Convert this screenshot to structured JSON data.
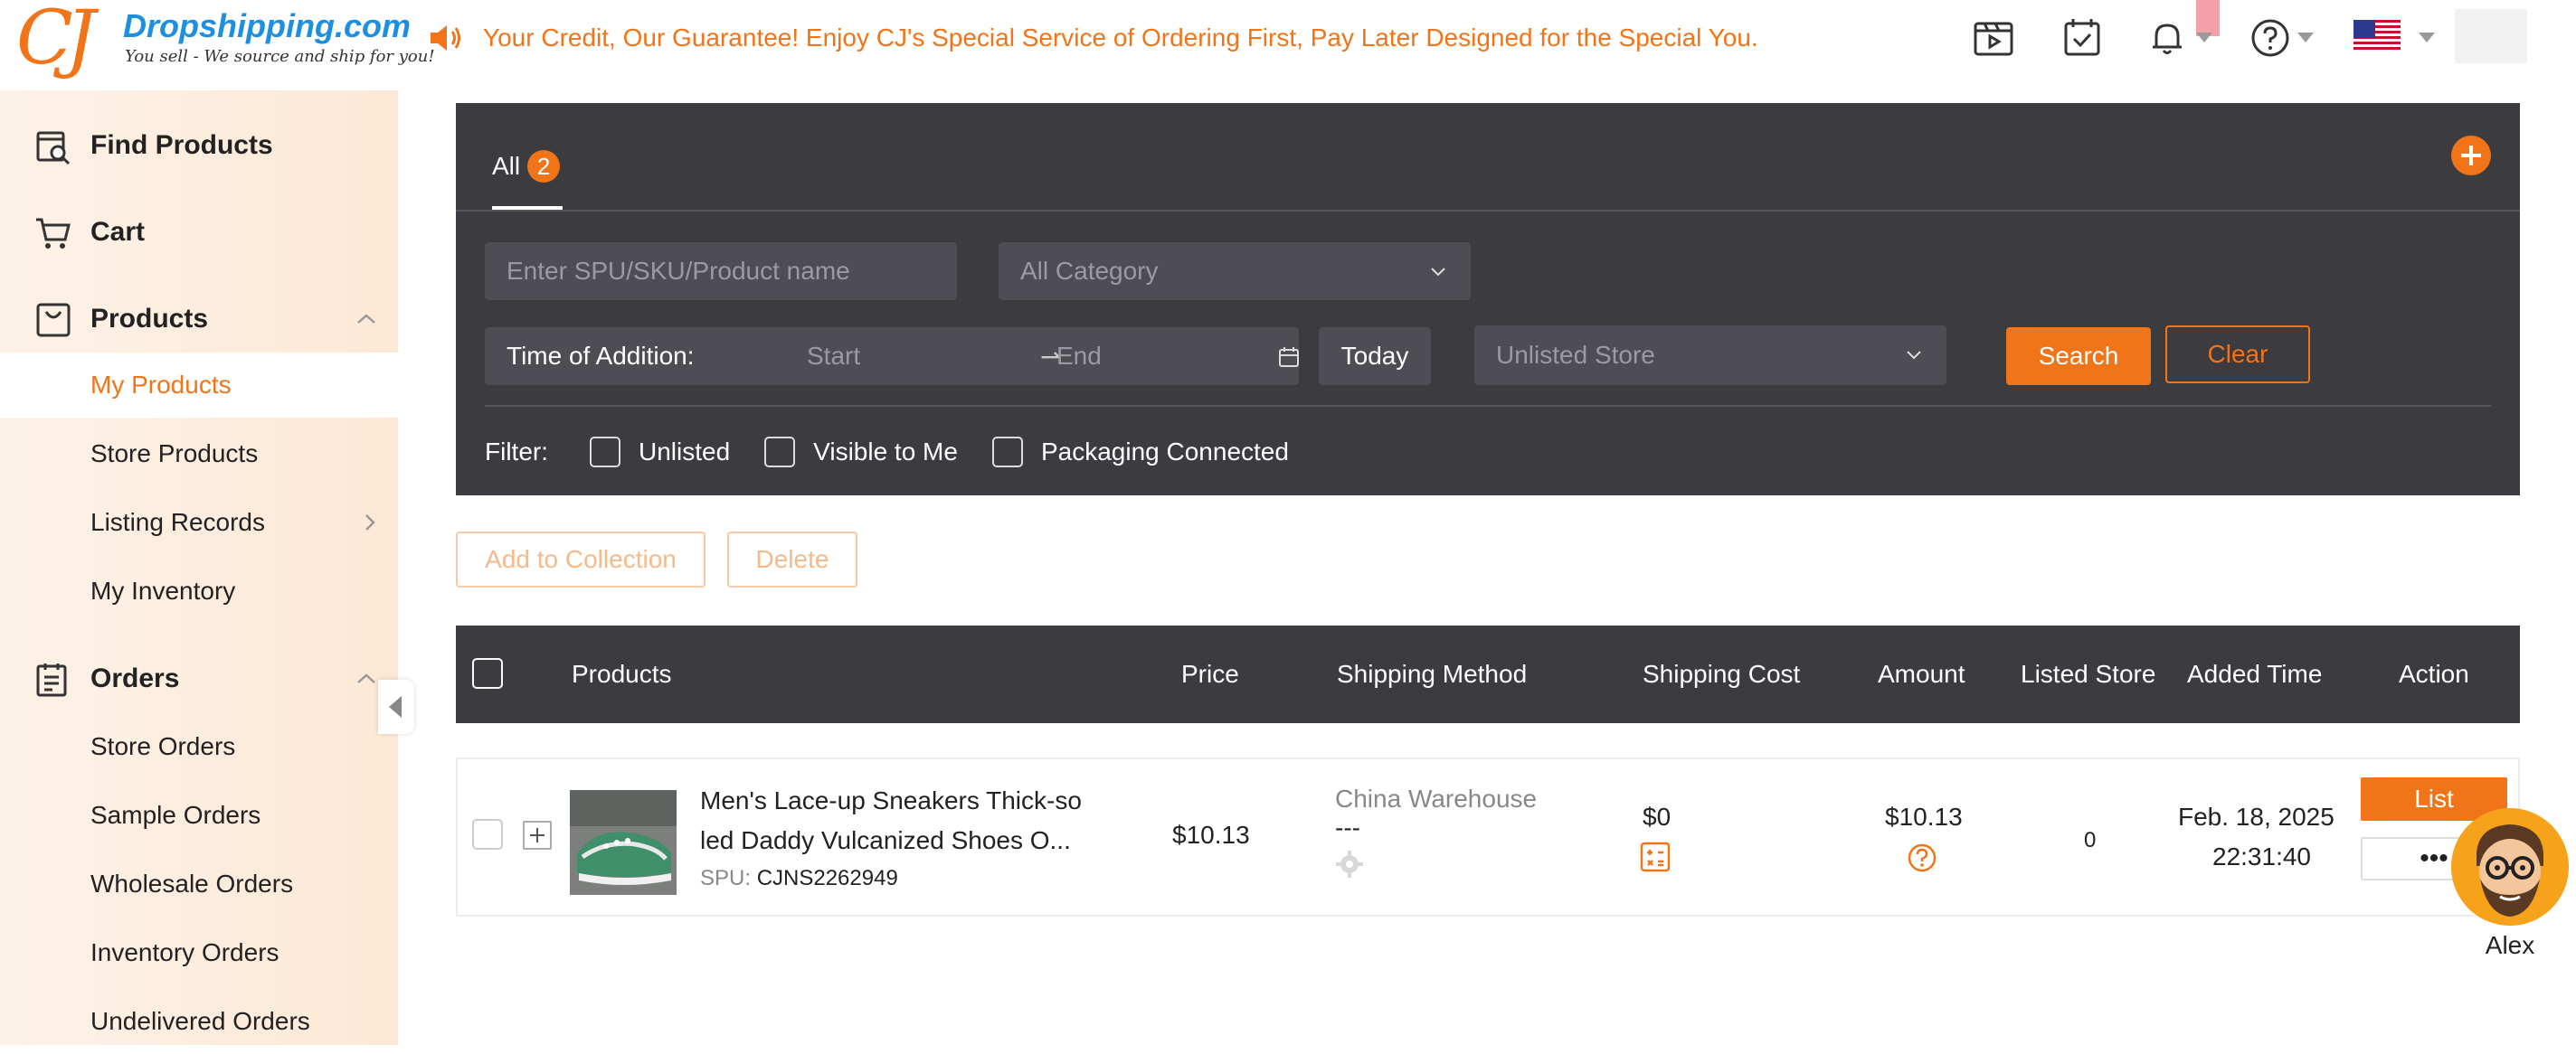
{
  "header": {
    "logo_mark": "CJ",
    "logo_name": "Dropshipping.com",
    "logo_tagline": "You sell - We source and ship for you!",
    "announcement": "Your Credit, Our Guarantee! Enjoy CJ's Special Service of Ordering First, Pay Later Designed for the Special You.",
    "icons": [
      "video-icon",
      "calendar-check-icon",
      "bell-icon",
      "help-icon",
      "us-flag-icon"
    ]
  },
  "sidebar": {
    "groups": [
      {
        "label": "Find Products",
        "icon": "find-products-icon"
      },
      {
        "label": "Cart",
        "icon": "cart-icon"
      },
      {
        "label": "Products",
        "icon": "bag-icon",
        "expanded": true,
        "items": [
          {
            "label": "My Products",
            "active": true
          },
          {
            "label": "Store Products"
          },
          {
            "label": "Listing Records",
            "has_submenu": true
          },
          {
            "label": "My Inventory"
          }
        ]
      },
      {
        "label": "Orders",
        "icon": "orders-icon",
        "expanded": true,
        "items": [
          {
            "label": "Store Orders"
          },
          {
            "label": "Sample Orders"
          },
          {
            "label": "Wholesale Orders"
          },
          {
            "label": "Inventory Orders"
          },
          {
            "label": "Undelivered Orders"
          }
        ]
      }
    ]
  },
  "filters": {
    "tab_label": "All",
    "tab_count": "2",
    "search_placeholder": "Enter SPU/SKU/Product name",
    "category_value": "All Category",
    "time_label": "Time of Addition:",
    "start_placeholder": "Start",
    "end_placeholder": "End",
    "today_label": "Today",
    "store_value": "Unlisted Store",
    "search_label": "Search",
    "clear_label": "Clear",
    "filter_label": "Filter:",
    "checkboxes": [
      "Unlisted",
      "Visible to Me",
      "Packaging Connected"
    ]
  },
  "actions": {
    "add_collection": "Add to Collection",
    "delete": "Delete"
  },
  "table": {
    "columns": [
      "Products",
      "Price",
      "Shipping Method",
      "Shipping Cost",
      "Amount",
      "Listed Store",
      "Added Time",
      "Action"
    ],
    "rows": [
      {
        "name_line1": "Men's Lace-up Sneakers Thick-so",
        "name_line2": "led Daddy Vulcanized Shoes O...",
        "spu_label": "SPU:",
        "spu": "CJNS2262949",
        "price": "$10.13",
        "shipping_method": "China Warehouse",
        "shipping_method_sub": "---",
        "shipping_cost": "$0",
        "amount": "$10.13",
        "listed_store": "0",
        "added_date": "Feb. 18, 2025",
        "added_time": "22:31:40",
        "list_label": "List",
        "more_label": "•••"
      }
    ]
  },
  "support": {
    "name": "Alex"
  },
  "colors": {
    "accent": "#f27418",
    "panel": "#3b3b40",
    "brand_blue": "#1d8fe0"
  }
}
